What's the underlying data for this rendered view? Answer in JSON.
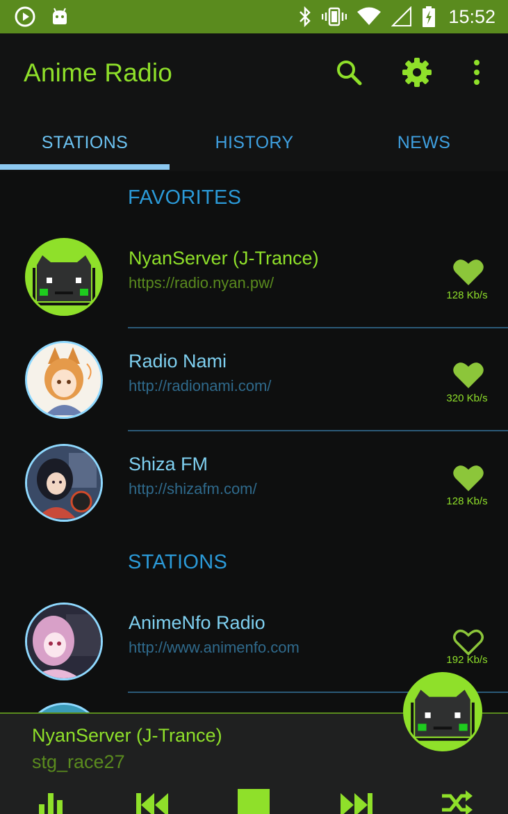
{
  "status_bar": {
    "time": "15:52",
    "icons": [
      "play-circle-icon",
      "android-icon",
      "bluetooth-icon",
      "vibrate-icon",
      "wifi-icon",
      "signal-icon",
      "battery-charging-icon"
    ]
  },
  "app_bar": {
    "title": "Anime Radio",
    "actions": [
      "search-icon",
      "gear-icon",
      "more-vert-icon"
    ]
  },
  "tabs": [
    {
      "label": "STATIONS",
      "active": true
    },
    {
      "label": "HISTORY",
      "active": false
    },
    {
      "label": "NEWS",
      "active": false
    }
  ],
  "sections": {
    "favorites": "FAVORITES",
    "stations": "STATIONS"
  },
  "favorites": [
    {
      "name": "NyanServer (J-Trance)",
      "url": "https://radio.nyan.pw/",
      "bitrate": "128 Kb/s",
      "favorite": true,
      "playing": true
    },
    {
      "name": "Radio Nami",
      "url": "http://radionami.com/",
      "bitrate": "320 Kb/s",
      "favorite": true,
      "playing": false
    },
    {
      "name": "Shiza FM",
      "url": "http://shizafm.com/",
      "bitrate": "128 Kb/s",
      "favorite": true,
      "playing": false
    }
  ],
  "stations": [
    {
      "name": "AnimeNfo Radio",
      "url": "http://www.animenfo.com",
      "bitrate": "192 Kb/s",
      "favorite": false
    }
  ],
  "player": {
    "title": "NyanServer (J-Trance)",
    "subtitle": "stg_race27",
    "controls": [
      "equalizer-icon",
      "skip-previous-icon",
      "stop-icon",
      "skip-next-icon",
      "shuffle-icon"
    ]
  },
  "colors": {
    "accent_green": "#8fe02a",
    "accent_blue": "#6cc3f2",
    "status_bar": "#5a8b1e",
    "background": "#0e0f0f"
  }
}
